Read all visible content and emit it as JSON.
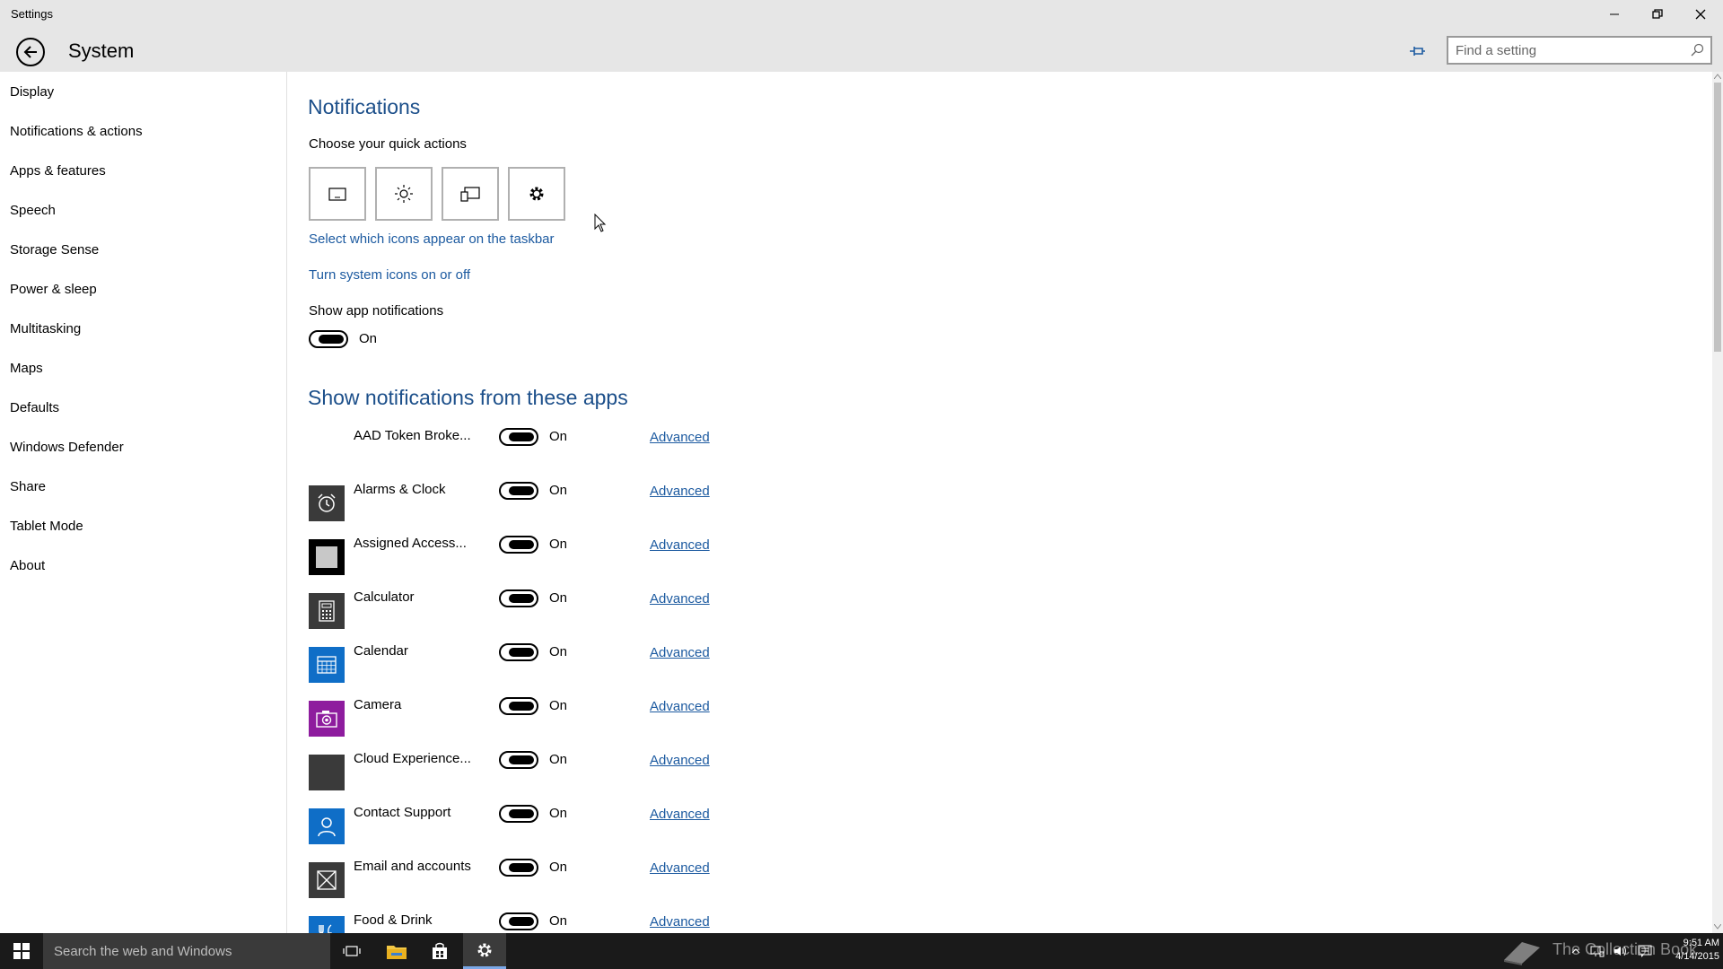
{
  "window": {
    "title": "Settings",
    "controls": {
      "minimize": "—",
      "maximize": "❐",
      "close": "✕"
    }
  },
  "header": {
    "title": "System",
    "search_placeholder": "Find a setting"
  },
  "sidebar": {
    "items": [
      {
        "label": "Display"
      },
      {
        "label": "Notifications & actions"
      },
      {
        "label": "Apps & features"
      },
      {
        "label": "Speech"
      },
      {
        "label": "Storage Sense"
      },
      {
        "label": "Power & sleep"
      },
      {
        "label": "Multitasking"
      },
      {
        "label": "Maps"
      },
      {
        "label": "Defaults"
      },
      {
        "label": "Windows Defender"
      },
      {
        "label": "Share"
      },
      {
        "label": "Tablet Mode"
      },
      {
        "label": "About"
      }
    ]
  },
  "main": {
    "title": "Notifications",
    "quick_actions_label": "Choose your quick actions",
    "quick_actions": [
      {
        "icon": "tablet-mode-icon"
      },
      {
        "icon": "brightness-icon"
      },
      {
        "icon": "connect-icon"
      },
      {
        "icon": "all-settings-icon"
      }
    ],
    "link_taskbar_icons": "Select which icons appear on the taskbar",
    "link_system_icons": "Turn system icons on or off",
    "show_app_notifications_label": "Show app notifications",
    "show_app_notifications_state": "On",
    "apps_section_title": "Show notifications from these apps",
    "apps": [
      {
        "name": "AAD Token Broke...",
        "state": "On",
        "advanced": "Advanced",
        "icon": "none",
        "color": ""
      },
      {
        "name": "Alarms & Clock",
        "state": "On",
        "advanced": "Advanced",
        "icon": "alarm-clock-icon",
        "color": "#3a3a3a"
      },
      {
        "name": "Assigned Access...",
        "state": "On",
        "advanced": "Advanced",
        "icon": "assigned-access-icon",
        "color": "#000000"
      },
      {
        "name": "Calculator",
        "state": "On",
        "advanced": "Advanced",
        "icon": "calculator-icon",
        "color": "#3a3a3a"
      },
      {
        "name": "Calendar",
        "state": "On",
        "advanced": "Advanced",
        "icon": "calendar-icon",
        "color": "#0f6ec7"
      },
      {
        "name": "Camera",
        "state": "On",
        "advanced": "Advanced",
        "icon": "camera-icon",
        "color": "#8e1c9e"
      },
      {
        "name": "Cloud Experience...",
        "state": "On",
        "advanced": "Advanced",
        "icon": "cloud-experience-icon",
        "color": "#3a3a3a"
      },
      {
        "name": "Contact Support",
        "state": "On",
        "advanced": "Advanced",
        "icon": "contact-support-icon",
        "color": "#0f6ec7"
      },
      {
        "name": "Email and accounts",
        "state": "On",
        "advanced": "Advanced",
        "icon": "email-icon",
        "color": "#3a3a3a"
      },
      {
        "name": "Food & Drink",
        "state": "On",
        "advanced": "Advanced",
        "icon": "food-drink-icon",
        "color": "#0f6ec7"
      }
    ]
  },
  "taskbar": {
    "search_placeholder": "Search the web and Windows",
    "watermark": "The Collection Book",
    "time": "9:51 AM",
    "date": "4/14/2015"
  }
}
